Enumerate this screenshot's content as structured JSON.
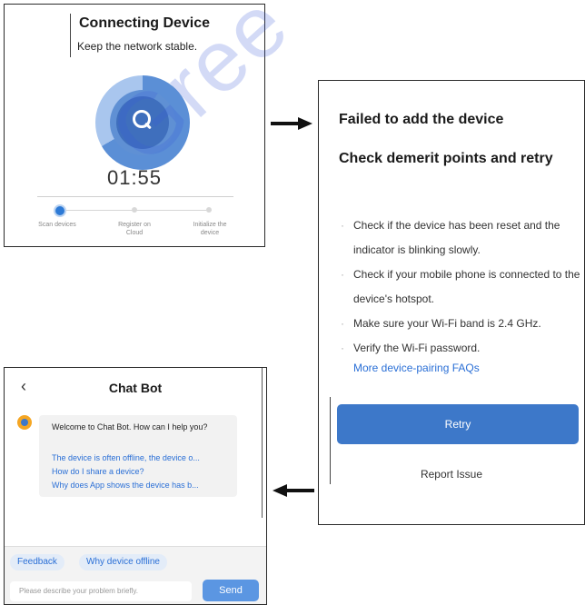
{
  "watermark": "Gree",
  "connecting": {
    "title": "Connecting Device",
    "subtitle": "Keep the network stable.",
    "timer": "01:55",
    "steps": [
      {
        "label": "Scan devices",
        "progress": 1
      },
      {
        "label": "Register on Cloud",
        "progress": 0
      },
      {
        "label": "Initialize the device",
        "progress": 0
      }
    ]
  },
  "failed": {
    "title": "Failed to add the device",
    "heading": "Check demerit points and retry",
    "tips": [
      "Check if the device has been reset and the indicator is blinking slowly.",
      "Check if your mobile phone is connected to the device's hotspot.",
      "Make sure your Wi-Fi band is 2.4 GHz.",
      "Verify the Wi-Fi password."
    ],
    "faq_link": "More device-pairing FAQs",
    "retry_label": "Retry",
    "report_label": "Report Issue"
  },
  "chat": {
    "back_icon": "‹",
    "title": "Chat Bot",
    "welcome": "Welcome to Chat Bot. How can I help you?",
    "questions": [
      "The device is often offline, the device o...",
      "How do I share a device?",
      "Why does App shows the device has b..."
    ],
    "chips": [
      "Feedback",
      "Why device offline"
    ],
    "input_placeholder": "Please describe your problem briefly.",
    "send_label": "Send"
  },
  "colors": {
    "accent": "#3d78c9",
    "link": "#2a6fd6",
    "watermark": "#3a5bd9"
  }
}
